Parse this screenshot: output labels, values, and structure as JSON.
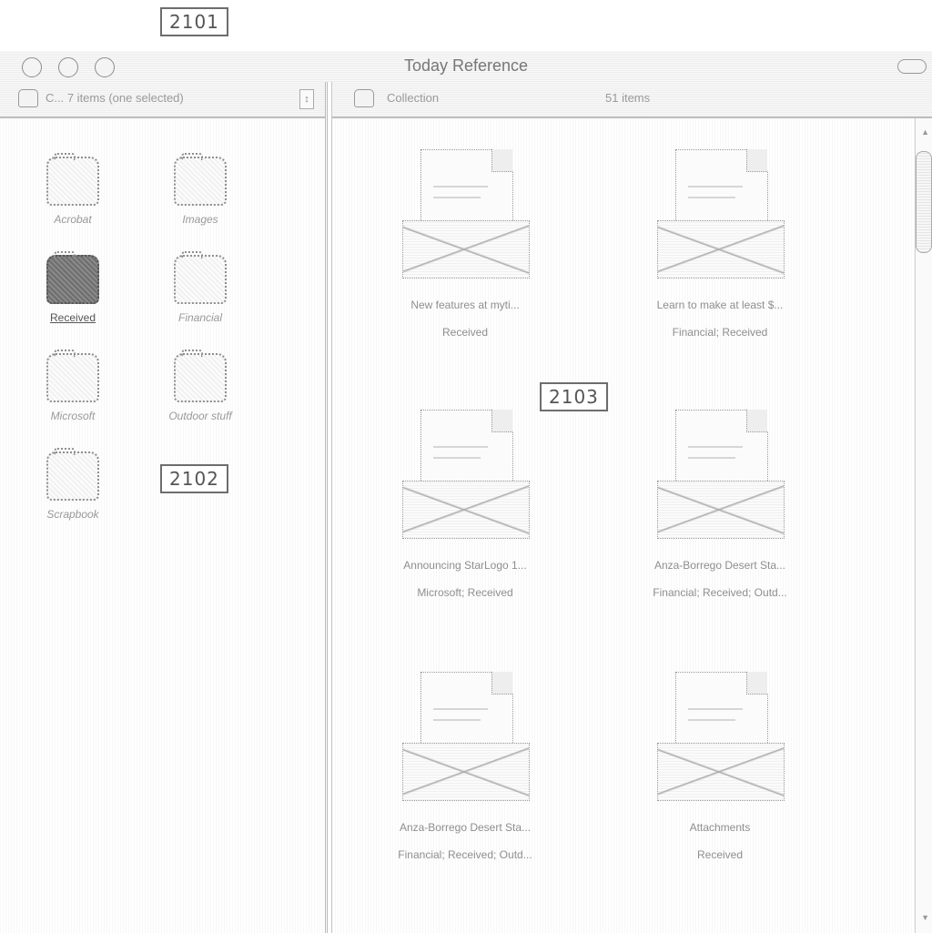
{
  "callouts": {
    "window": "2101",
    "left_pane": "2102",
    "right_pane": "2103"
  },
  "window": {
    "title": "Today Reference"
  },
  "left_pane": {
    "header": "C... 7 items (one selected)",
    "folders": [
      {
        "label": "Acrobat",
        "selected": false
      },
      {
        "label": "Images",
        "selected": false
      },
      {
        "label": "Received",
        "selected": true
      },
      {
        "label": "Financial",
        "selected": false
      },
      {
        "label": "Microsoft",
        "selected": false
      },
      {
        "label": "Outdoor stuff",
        "selected": false
      },
      {
        "label": "Scrapbook",
        "selected": false
      }
    ]
  },
  "right_pane": {
    "header_title": "Collection",
    "header_count": "51 items",
    "documents": [
      {
        "title": "New features at myti...",
        "tags": "Received"
      },
      {
        "title": "Learn to make at least $...",
        "tags": "Financial; Received"
      },
      {
        "title": "Announcing StarLogo 1...",
        "tags": "Microsoft; Received"
      },
      {
        "title": "Anza-Borrego Desert Sta...",
        "tags": "Financial; Received; Outd..."
      },
      {
        "title": "Anza-Borrego Desert Sta...",
        "tags": "Financial; Received; Outd..."
      },
      {
        "title": "Attachments",
        "tags": "Received"
      }
    ]
  }
}
